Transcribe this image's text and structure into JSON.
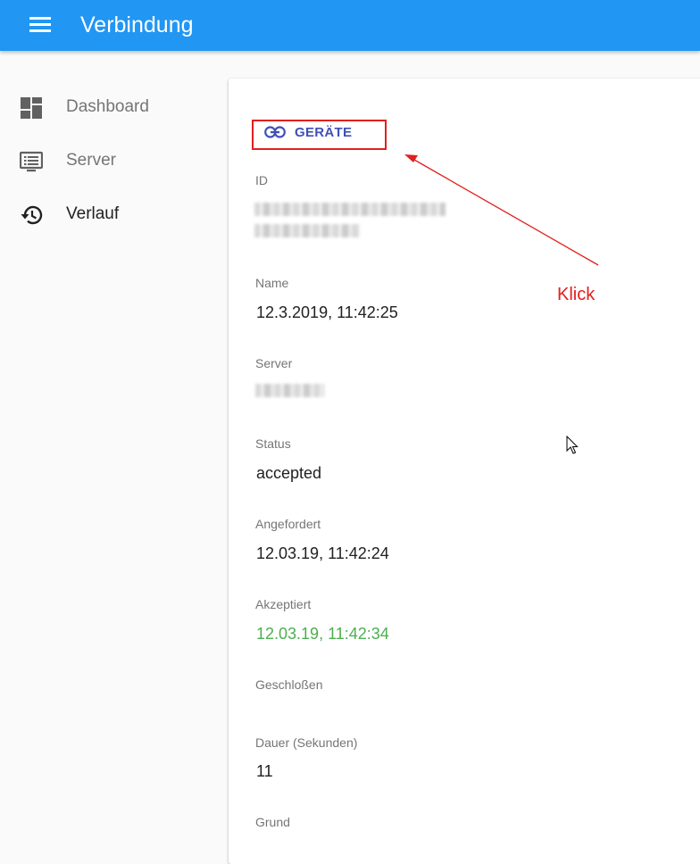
{
  "header": {
    "menu_icon": "menu-icon",
    "title": "Verbindung",
    "color": "#2196f3"
  },
  "sidebar": {
    "items": [
      {
        "label": "Dashboard",
        "icon": "dashboard-icon",
        "active": false
      },
      {
        "label": "Server",
        "icon": "monitor-icon",
        "active": false
      },
      {
        "label": "Verlauf",
        "icon": "history-icon",
        "active": true
      }
    ]
  },
  "detail": {
    "devices_button": {
      "label": "GERÄTE",
      "icon": "link-icon",
      "color": "#3f51b5"
    },
    "fields": [
      {
        "label": "ID",
        "value": ""
      },
      {
        "label": "Name",
        "value": "12.3.2019, 11:42:25"
      },
      {
        "label": "Server",
        "value": ""
      },
      {
        "label": "Status",
        "value": "accepted"
      },
      {
        "label": "Angefordert",
        "value": "12.03.19, 11:42:24"
      },
      {
        "label": "Akzeptiert",
        "value": "12.03.19, 11:42:34",
        "color": "#4caf50"
      },
      {
        "label": "Geschloßen",
        "value": ""
      },
      {
        "label": "Dauer (Sekunden)",
        "value": "11"
      },
      {
        "label": "Grund",
        "value": ""
      }
    ]
  },
  "annotation": {
    "text": "Klick",
    "color": "#e0201e"
  }
}
